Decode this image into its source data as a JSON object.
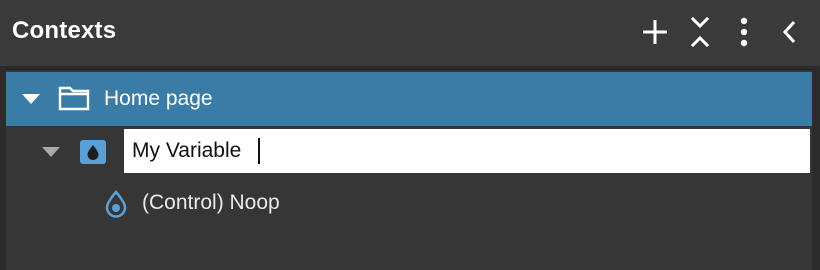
{
  "header": {
    "title": "Contexts",
    "actions": {
      "add_icon": "plus-icon",
      "collapse_icon": "collapse-all-icon",
      "more_icon": "vertical-dots-icon",
      "back_icon": "chevron-left-icon"
    }
  },
  "tree": {
    "colors": {
      "selected_row": "#3a7ca5",
      "icon_accent": "#5aa0d6",
      "background": "#363636"
    },
    "items": [
      {
        "label": "Home page",
        "icon": "folder-icon",
        "expanded": true,
        "selected": true
      },
      {
        "value": "My Variable",
        "icon": "variable-drop-icon",
        "expanded": true,
        "editing": true
      },
      {
        "label": "(Control) Noop",
        "icon": "control-drop-icon"
      }
    ]
  }
}
